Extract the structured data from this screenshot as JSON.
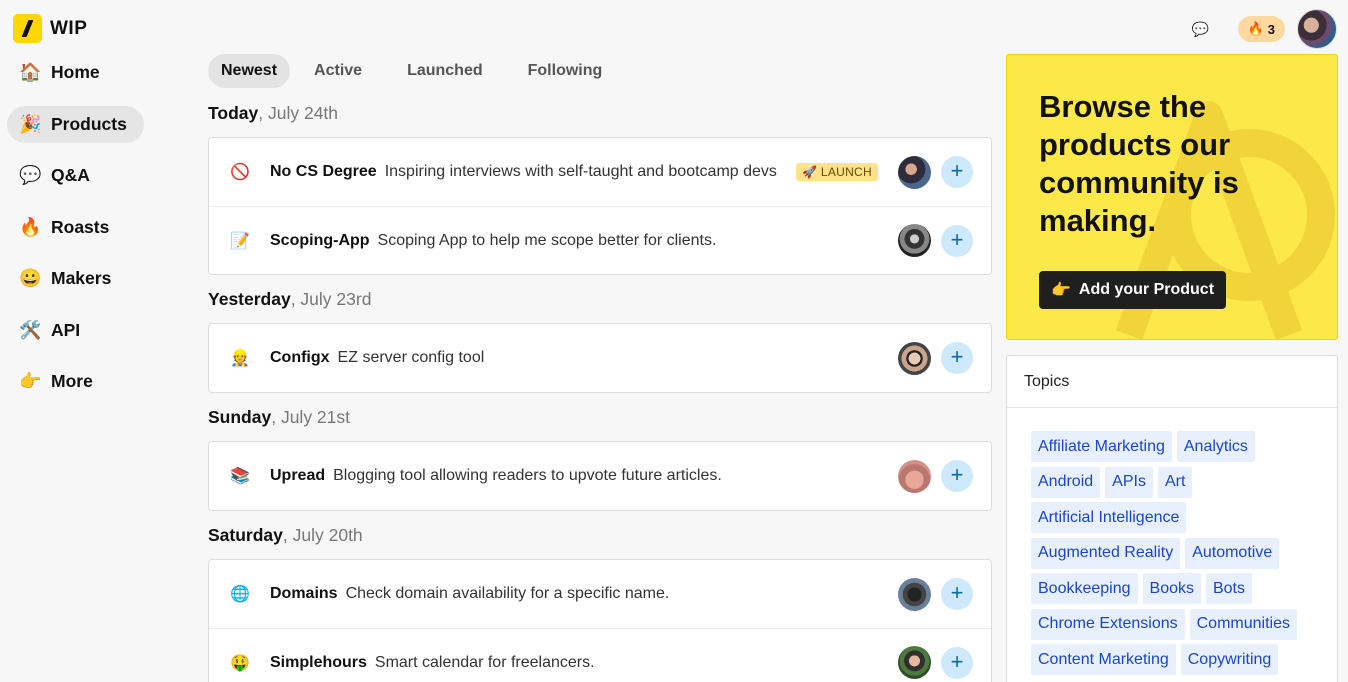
{
  "logo": {
    "text": "WIP"
  },
  "sidebar": {
    "items": [
      {
        "label": "Home",
        "icon": "🏠",
        "icon_name": "house-icon"
      },
      {
        "label": "Products",
        "icon": "🎉",
        "icon_name": "party-popper-icon",
        "active": true
      },
      {
        "label": "Q&A",
        "icon": "💬",
        "icon_name": "speech-bubble-icon"
      },
      {
        "label": "Roasts",
        "icon": "🔥",
        "icon_name": "fire-icon"
      },
      {
        "label": "Makers",
        "icon": "😀",
        "icon_name": "smiley-icon"
      },
      {
        "label": "API",
        "icon": "🛠️",
        "icon_name": "tools-icon"
      },
      {
        "label": "More",
        "icon": "👉",
        "icon_name": "pointing-hand-icon"
      }
    ]
  },
  "topbar": {
    "chat_icon": "💬",
    "streak_icon": "🔥",
    "streak_count": "3"
  },
  "tabs": [
    {
      "label": "Newest",
      "active": true
    },
    {
      "label": "Active"
    },
    {
      "label": "Launched"
    },
    {
      "label": "Following"
    }
  ],
  "feed": [
    {
      "day": "Today",
      "date": ", July 24th",
      "products": [
        {
          "icon": "🚫",
          "name": "No CS Degree",
          "desc": "Inspiring interviews with self-taught and bootcamp devs",
          "badge": "🚀 LAUNCH",
          "avatar": "av-0"
        },
        {
          "icon": "📝",
          "name": "Scoping-App",
          "desc": "Scoping App to help me scope better for clients.",
          "avatar": "av-1"
        }
      ]
    },
    {
      "day": "Yesterday",
      "date": ", July 23rd",
      "products": [
        {
          "icon": "👷",
          "name": "Configx",
          "desc": "EZ server config tool",
          "avatar": "av-2"
        }
      ]
    },
    {
      "day": "Sunday",
      "date": ", July 21st",
      "products": [
        {
          "icon": "📚",
          "name": "Upread",
          "desc": "Blogging tool allowing readers to upvote future articles.",
          "avatar": "av-3"
        }
      ]
    },
    {
      "day": "Saturday",
      "date": ", July 20th",
      "products": [
        {
          "icon": "🌐",
          "name": "Domains",
          "desc": "Check domain availability for a specific name.",
          "avatar": "av-4"
        },
        {
          "icon": "🤑",
          "name": "Simplehours",
          "desc": "Smart calendar for freelancers.",
          "avatar": "av-5"
        }
      ]
    }
  ],
  "promo": {
    "title": "Browse the products our community is making.",
    "button_icon": "👉",
    "button_label": "Add your Product"
  },
  "topics": {
    "heading": "Topics",
    "items": [
      "Affiliate Marketing",
      "Analytics",
      "Android",
      "APIs",
      "Art",
      "Artificial Intelligence",
      "Augmented Reality",
      "Automotive",
      "Bookkeeping",
      "Books",
      "Bots",
      "Chrome Extensions",
      "Communities",
      "Content Marketing",
      "Copywriting"
    ]
  },
  "colors": {
    "accent_yellow": "#fde84a",
    "plus_button_bg": "#cde9fb",
    "topic_link": "#1a45c8"
  }
}
